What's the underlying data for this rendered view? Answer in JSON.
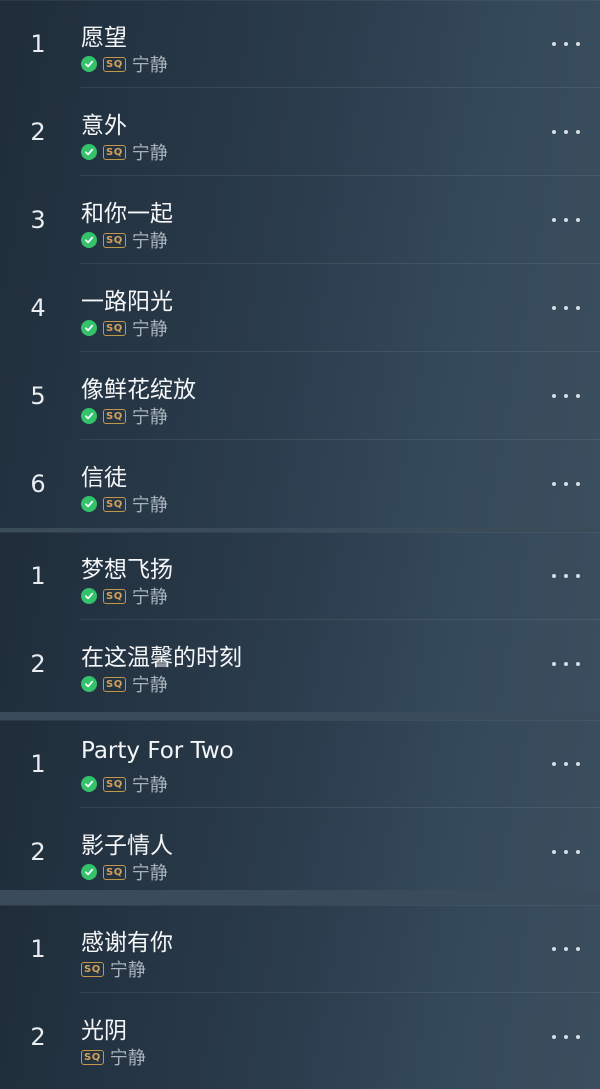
{
  "colors": {
    "accent_download": "#34c26a",
    "sq_badge": "#c4964b",
    "background": "#24313e"
  },
  "sections": [
    {
      "tracks": [
        {
          "index": "1",
          "title": "愿望",
          "downloaded": true,
          "quality": "SQ",
          "artist": "宁静"
        },
        {
          "index": "2",
          "title": "意外",
          "downloaded": true,
          "quality": "SQ",
          "artist": "宁静"
        },
        {
          "index": "3",
          "title": "和你一起",
          "downloaded": true,
          "quality": "SQ",
          "artist": "宁静"
        },
        {
          "index": "4",
          "title": "一路阳光",
          "downloaded": true,
          "quality": "SQ",
          "artist": "宁静"
        },
        {
          "index": "5",
          "title": "像鲜花绽放",
          "downloaded": true,
          "quality": "SQ",
          "artist": "宁静"
        },
        {
          "index": "6",
          "title": "信徒",
          "downloaded": true,
          "quality": "SQ",
          "artist": "宁静"
        }
      ]
    },
    {
      "tracks": [
        {
          "index": "1",
          "title": "梦想飞扬",
          "downloaded": true,
          "quality": "SQ",
          "artist": "宁静"
        },
        {
          "index": "2",
          "title": "在这温馨的时刻",
          "downloaded": true,
          "quality": "SQ",
          "artist": "宁静"
        }
      ]
    },
    {
      "tracks": [
        {
          "index": "1",
          "title": "Party For Two",
          "downloaded": true,
          "quality": "SQ",
          "artist": "宁静"
        },
        {
          "index": "2",
          "title": "影子情人",
          "downloaded": true,
          "quality": "SQ",
          "artist": "宁静"
        }
      ]
    },
    {
      "tracks": [
        {
          "index": "1",
          "title": "感谢有你",
          "downloaded": false,
          "quality": "SQ",
          "artist": "宁静"
        },
        {
          "index": "2",
          "title": "光阴",
          "downloaded": false,
          "quality": "SQ",
          "artist": "宁静"
        }
      ]
    }
  ]
}
